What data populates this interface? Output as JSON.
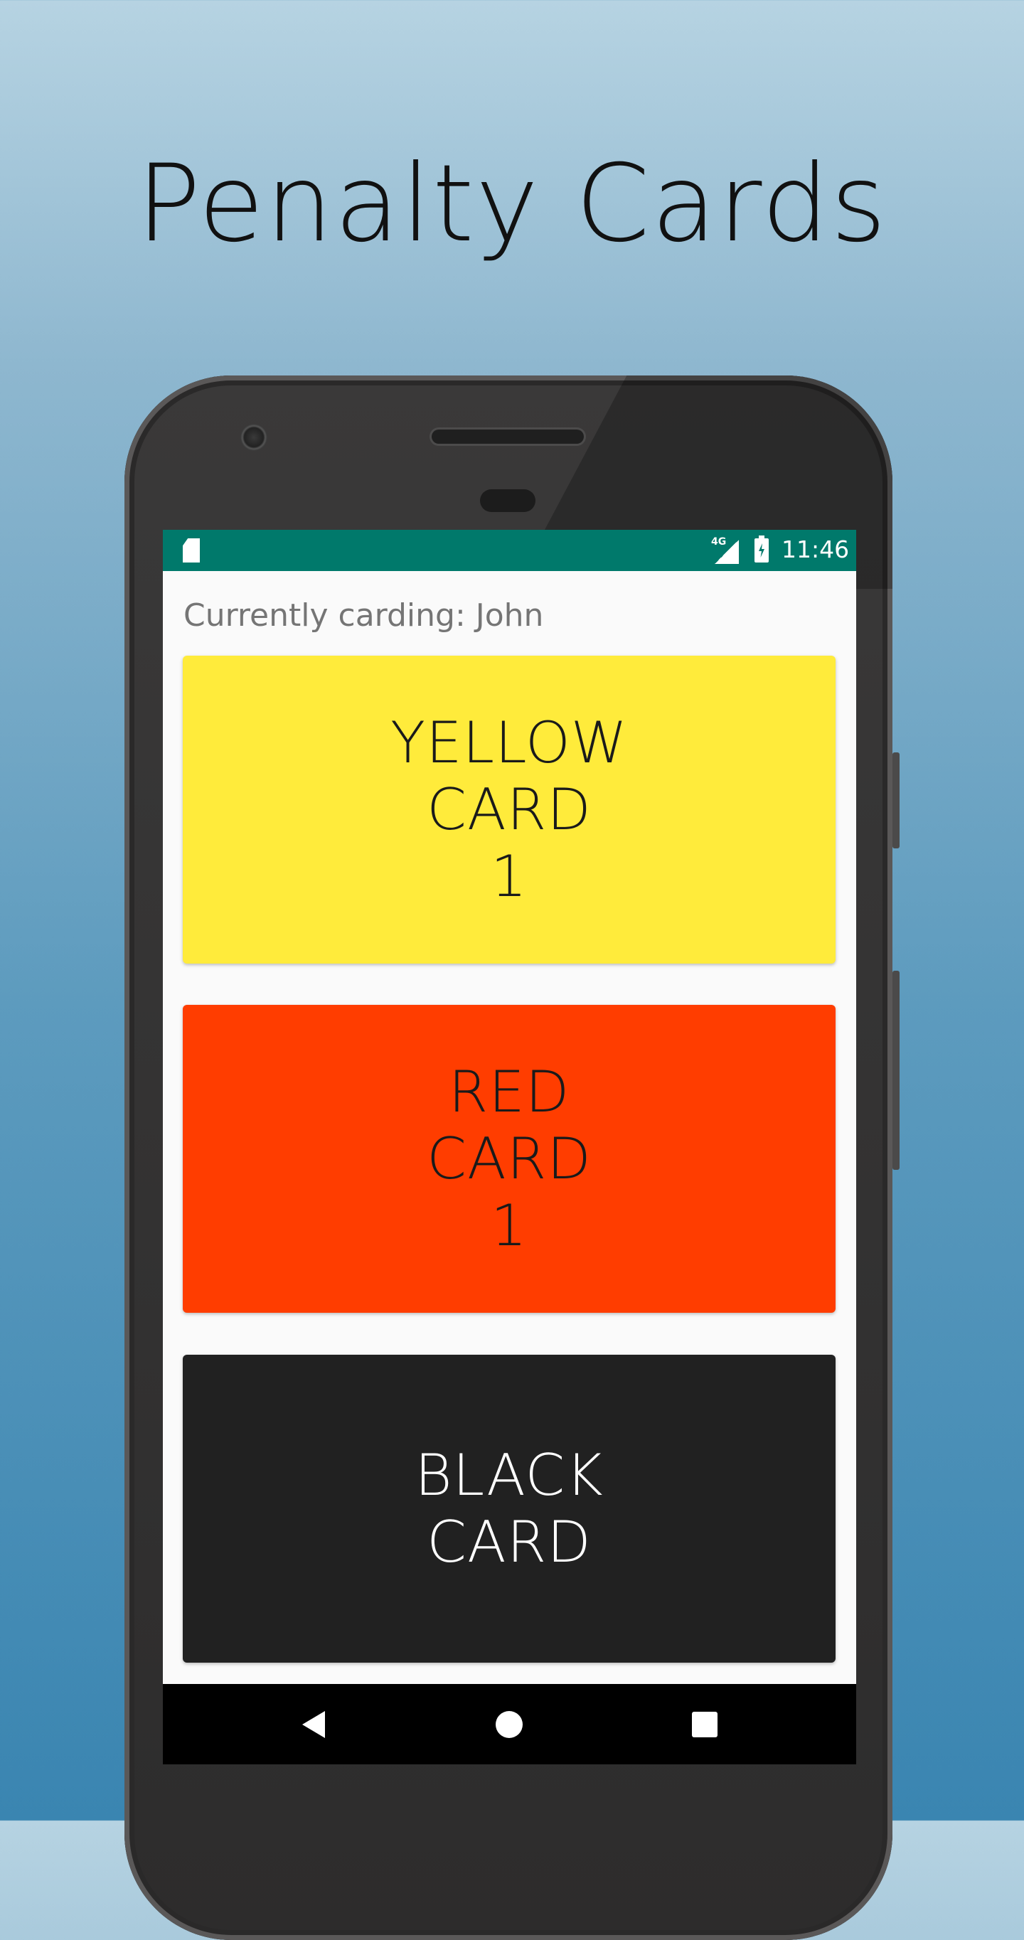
{
  "headline": "Penalty Cards",
  "status_bar": {
    "network": "4G",
    "time": "11:46",
    "icons": [
      "sd-card-icon",
      "signal-icon",
      "battery-charging-icon"
    ],
    "background_color": "#00796b"
  },
  "app": {
    "carding_label": "Currently carding: John",
    "cards": [
      {
        "line1": "YELLOW",
        "line2": "CARD",
        "count": "1",
        "color": "#ffeb3b"
      },
      {
        "line1": "RED",
        "line2": "CARD",
        "count": "1",
        "color": "#ff3d00"
      },
      {
        "line1": "BLACK",
        "line2": "CARD",
        "color": "#212121"
      }
    ]
  },
  "nav_bar": {
    "icons": [
      "back-icon",
      "home-icon",
      "recents-icon"
    ]
  }
}
